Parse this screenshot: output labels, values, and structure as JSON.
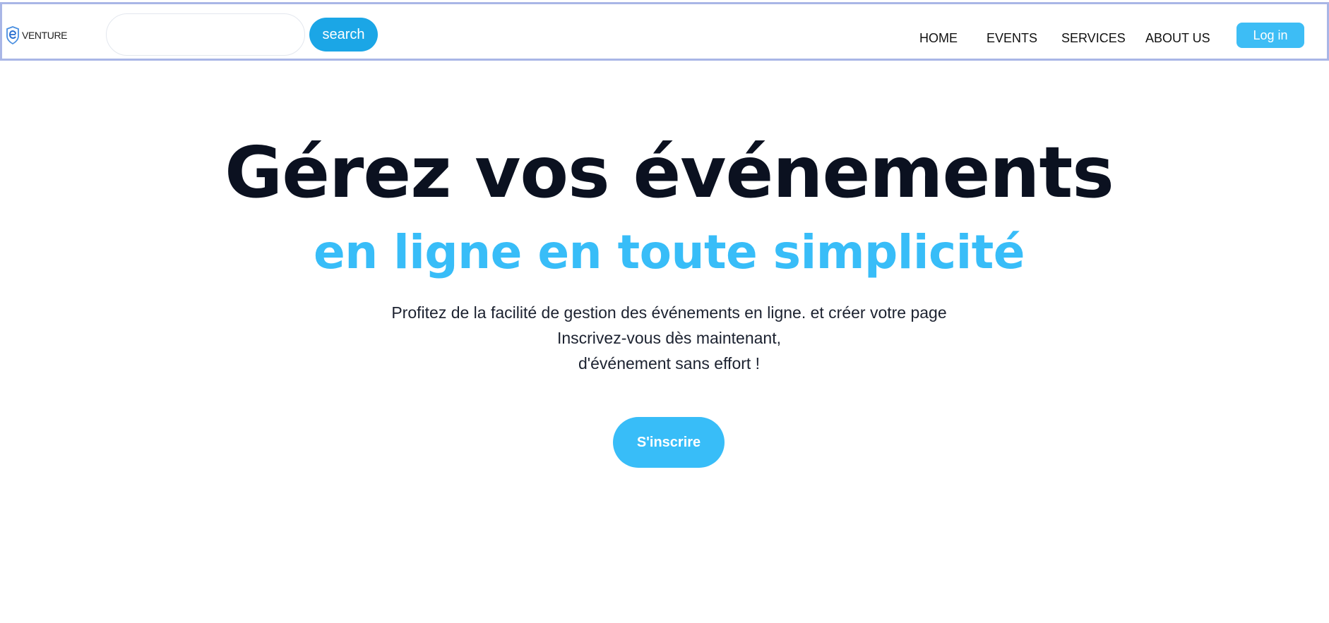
{
  "header": {
    "logo_text": "VENTURE",
    "search": {
      "value": "",
      "placeholder": "",
      "button_label": "search"
    },
    "nav": [
      {
        "label": "HOME"
      },
      {
        "label": "EVENTS"
      },
      {
        "label": "SERVICES"
      },
      {
        "label": "ABOUT US"
      }
    ],
    "login_label": "Log in"
  },
  "hero": {
    "title": "Gérez vos événements",
    "subtitle": "en ligne en toute simplicité",
    "description": [
      "Profitez de la facilité de gestion des événements en ligne. et créer votre page",
      "Inscrivez-vous dès maintenant,",
      "d'événement sans effort !"
    ],
    "cta_label": "S'inscrire"
  },
  "colors": {
    "accent": "#38bdf8",
    "search_button": "#1ba6e6",
    "title_text": "#0b1120",
    "navbar_border": "#a9b6e6"
  },
  "icons": {
    "logo": "eventure-logo-icon"
  }
}
